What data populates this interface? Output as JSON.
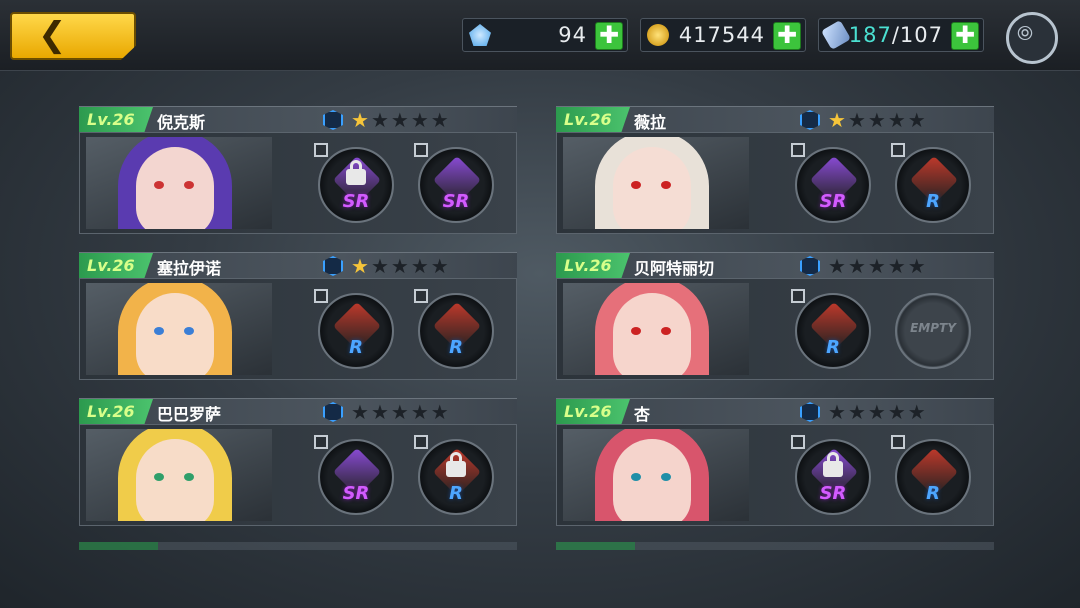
{
  "topbar": {
    "back_icon": "chevron-left-icon",
    "resources": {
      "gems": {
        "icon": "gem-icon",
        "value": "94"
      },
      "coins": {
        "icon": "coin-icon",
        "value": "417544"
      },
      "stamina": {
        "icon": "ticket-icon",
        "current": "187",
        "sep_max": "/107"
      }
    },
    "plus_label": "✚",
    "network_icon": "wifi-ring-icon"
  },
  "characters": [
    {
      "level": "Lv.26",
      "name": "倪克斯",
      "stars": 1,
      "slots": [
        {
          "rarity": "SR",
          "locked": true,
          "empty": false
        },
        {
          "rarity": "SR",
          "locked": false,
          "empty": false
        }
      ]
    },
    {
      "level": "Lv.26",
      "name": "薇拉",
      "stars": 1,
      "slots": [
        {
          "rarity": "SR",
          "locked": false,
          "empty": false
        },
        {
          "rarity": "R",
          "locked": false,
          "empty": false
        }
      ]
    },
    {
      "level": "Lv.26",
      "name": "塞拉伊诺",
      "stars": 1,
      "slots": [
        {
          "rarity": "R",
          "locked": false,
          "empty": false
        },
        {
          "rarity": "R",
          "locked": false,
          "empty": false
        }
      ]
    },
    {
      "level": "Lv.26",
      "name": "贝阿特丽切",
      "stars": 0,
      "slots": [
        {
          "rarity": "R",
          "locked": false,
          "empty": false
        },
        {
          "rarity": "",
          "locked": false,
          "empty": true,
          "empty_label": "EMPTY"
        }
      ]
    },
    {
      "level": "Lv.26",
      "name": "巴巴罗萨",
      "stars": 0,
      "slots": [
        {
          "rarity": "SR",
          "locked": false,
          "empty": false
        },
        {
          "rarity": "R",
          "locked": true,
          "empty": false
        }
      ]
    },
    {
      "level": "Lv.26",
      "name": "杏",
      "stars": 0,
      "slots": [
        {
          "rarity": "SR",
          "locked": true,
          "empty": false
        },
        {
          "rarity": "R",
          "locked": false,
          "empty": false
        }
      ]
    }
  ],
  "colors": {
    "accent_green": "#3cc43c",
    "star_lit": "#f6c53a",
    "sr": "#d35bff",
    "r": "#4da6ff",
    "level_text": "#d8ff8a"
  }
}
